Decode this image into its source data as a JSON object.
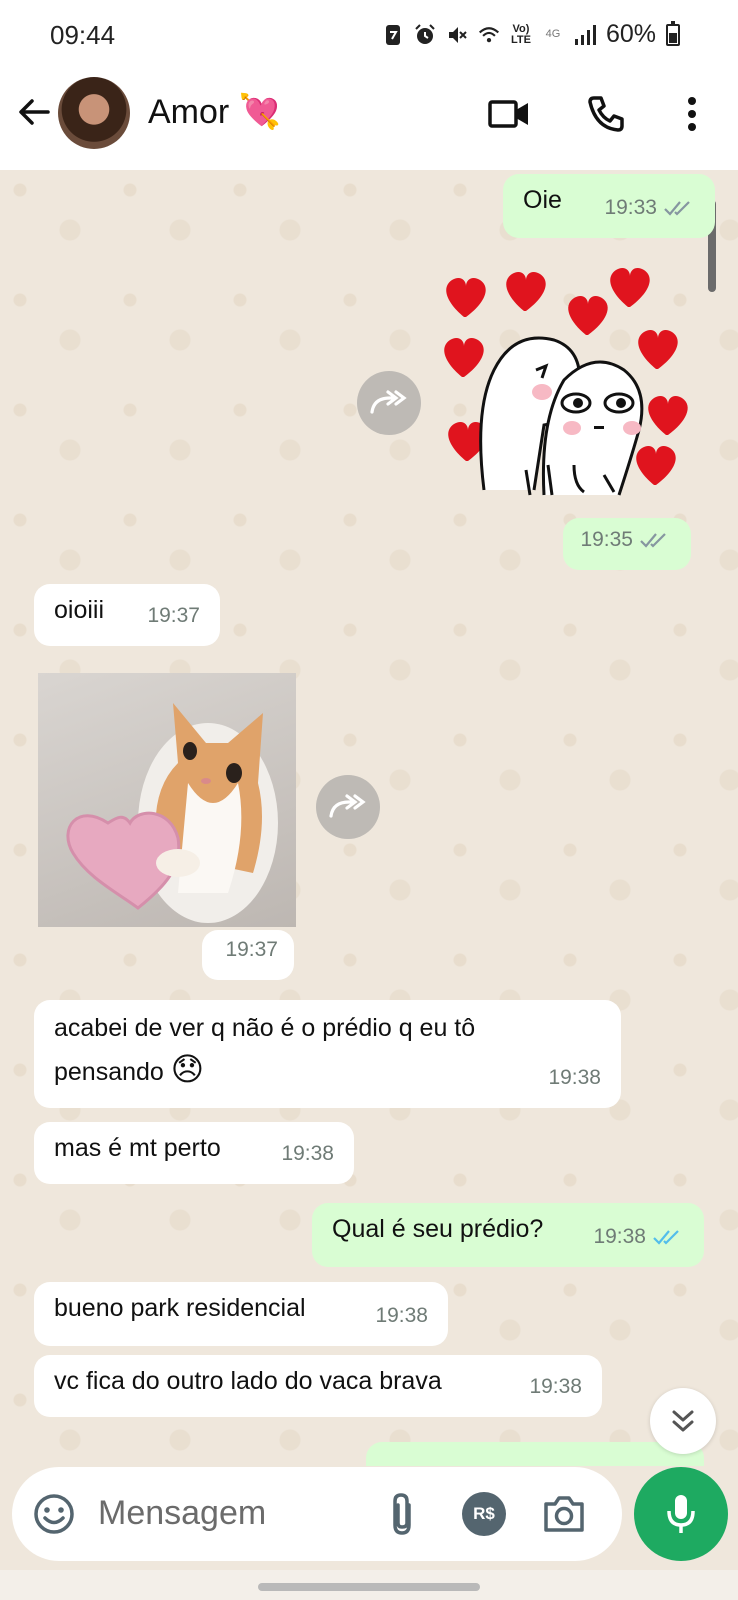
{
  "status_bar": {
    "time": "09:44",
    "lte_label": "Vo)\nLTE",
    "net_label": "4G",
    "battery": "60%"
  },
  "header": {
    "contact_name": "Amor",
    "contact_emoji": "💘",
    "back_icon": "arrow-left-icon",
    "video_icon": "video-camera-icon",
    "call_icon": "phone-icon",
    "menu_icon": "more-vert-icon"
  },
  "messages": [
    {
      "dir": "out",
      "text": "Oie",
      "time": "19:33",
      "status": "read-grey"
    },
    {
      "dir": "out",
      "type": "sticker",
      "time": "19:35",
      "status": "read-grey"
    },
    {
      "dir": "in",
      "text": "oioiii",
      "time": "19:37"
    },
    {
      "dir": "in",
      "type": "sticker",
      "time": "19:37"
    },
    {
      "dir": "in",
      "text": "acabei de ver q não é o prédio q eu tô pensando 😞",
      "line1": "acabei de ver q não é o prédio q eu tô",
      "line2": "pensando",
      "emoji": "😞",
      "time": "19:38"
    },
    {
      "dir": "in",
      "text": "mas é mt perto",
      "time": "19:38"
    },
    {
      "dir": "out",
      "text": "Qual é seu prédio?",
      "time": "19:38",
      "status": "read-blue"
    },
    {
      "dir": "in",
      "text": "bueno park residencial",
      "time": "19:38"
    },
    {
      "dir": "in",
      "text": "vc fica do outro lado do vaca brava",
      "time": "19:38"
    }
  ],
  "input": {
    "placeholder": "Mensagem",
    "currency_label": "R$"
  },
  "colors": {
    "outgoing": "#d9fdd3",
    "incoming": "#ffffff",
    "accent": "#1eaa61",
    "read_blue": "#53bdeb",
    "tick_grey": "#8696a0"
  }
}
